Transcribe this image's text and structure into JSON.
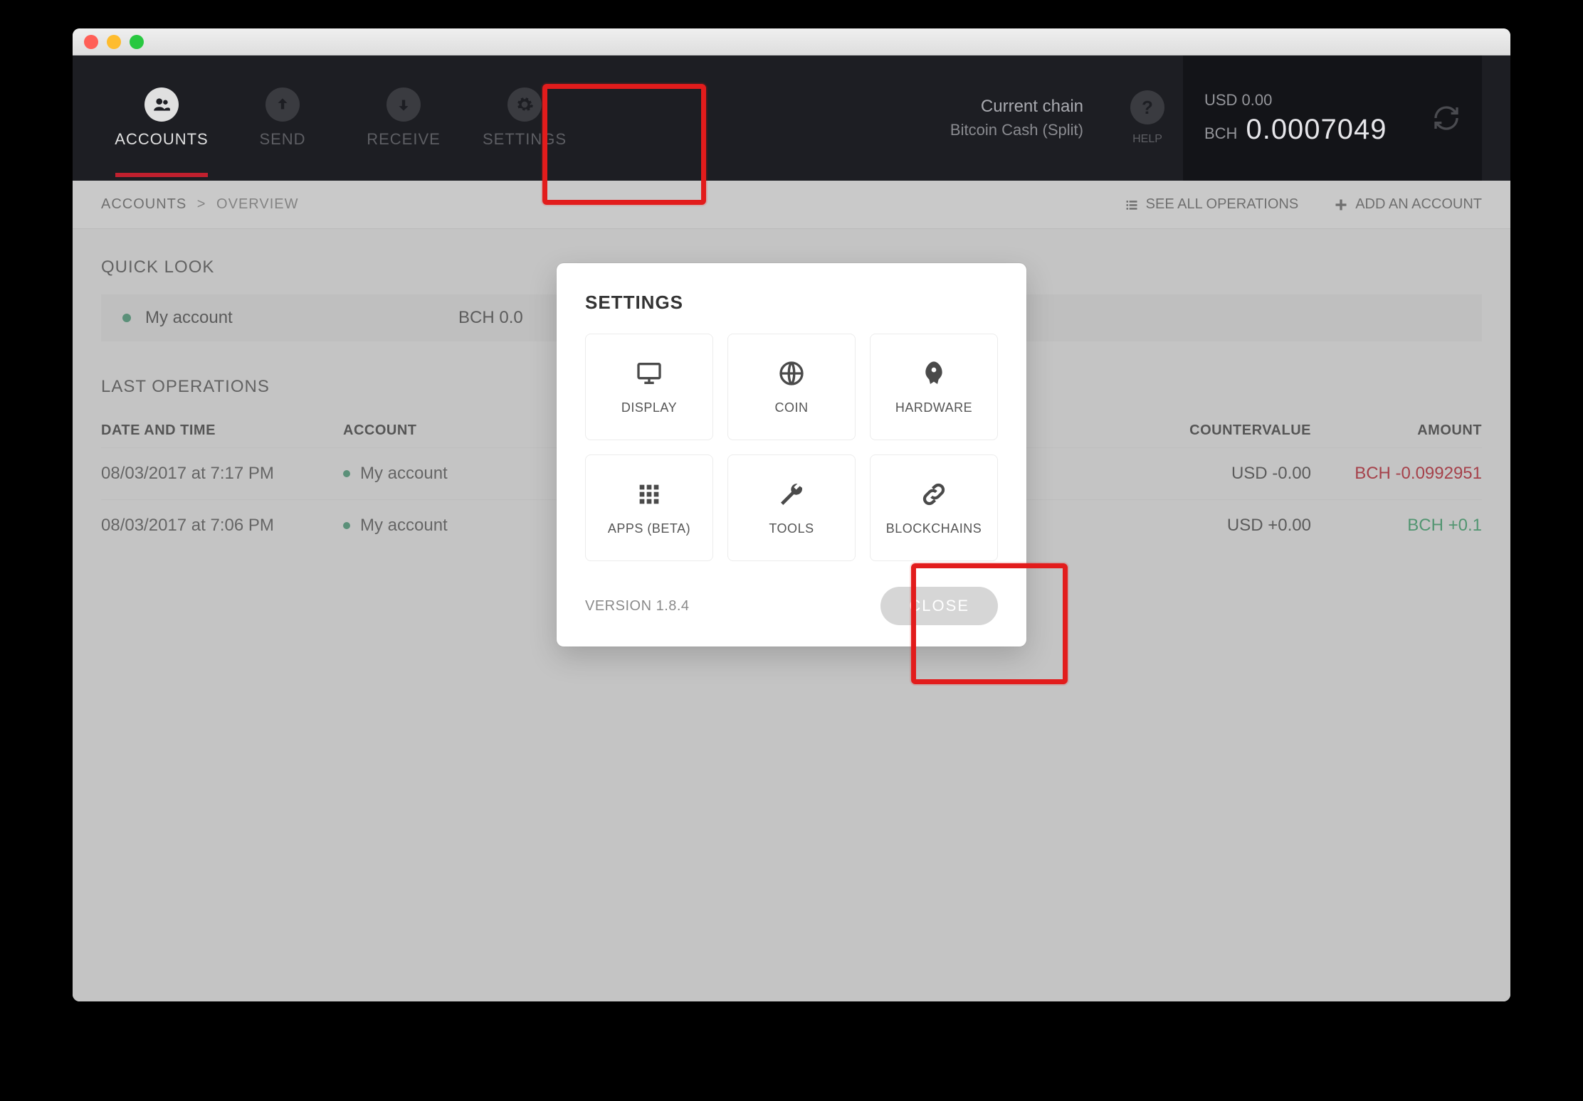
{
  "nav": {
    "items": [
      {
        "label": "ACCOUNTS",
        "icon": "users",
        "active": true
      },
      {
        "label": "SEND",
        "icon": "arrow-up",
        "active": false
      },
      {
        "label": "RECEIVE",
        "icon": "arrow-down",
        "active": false
      },
      {
        "label": "SETTINGS",
        "icon": "gear",
        "active": false
      }
    ],
    "help_label": "HELP"
  },
  "chain": {
    "title": "Current chain",
    "name": "Bitcoin Cash (Split)"
  },
  "balance": {
    "usd_label": "USD 0.00",
    "sym": "BCH",
    "amount": "0.0007049"
  },
  "subbar": {
    "crumb_root": "ACCOUNTS",
    "crumb_sep": ">",
    "crumb_leaf": "OVERVIEW",
    "see_all": "SEE ALL OPERATIONS",
    "add_account": "ADD AN ACCOUNT"
  },
  "quicklook": {
    "title": "QUICK LOOK",
    "account_name": "My account",
    "balance": "BCH 0.0"
  },
  "ops": {
    "title": "LAST OPERATIONS",
    "headers": {
      "date": "DATE AND TIME",
      "account": "ACCOUNT",
      "counter": "COUNTERVALUE",
      "amount": "AMOUNT"
    },
    "rows": [
      {
        "date": "08/03/2017 at 7:17 PM",
        "account": "My account",
        "counter": "USD -0.00",
        "amount": "BCH -0.0992951",
        "neg": true
      },
      {
        "date": "08/03/2017 at 7:06 PM",
        "account": "My account",
        "counter": "USD +0.00",
        "amount": "BCH +0.1",
        "neg": false
      }
    ]
  },
  "modal": {
    "title": "SETTINGS",
    "tiles": [
      {
        "label": "DISPLAY",
        "icon": "monitor"
      },
      {
        "label": "COIN",
        "icon": "globe"
      },
      {
        "label": "HARDWARE",
        "icon": "rocket"
      },
      {
        "label": "APPS (BETA)",
        "icon": "grid"
      },
      {
        "label": "TOOLS",
        "icon": "wrench"
      },
      {
        "label": "BLOCKCHAINS",
        "icon": "link"
      }
    ],
    "version": "VERSION 1.8.4",
    "close": "CLOSE"
  }
}
